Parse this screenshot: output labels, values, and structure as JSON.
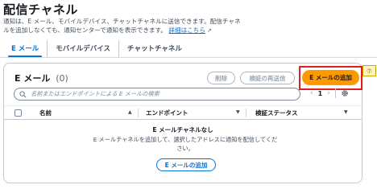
{
  "page": {
    "title": "配信チャネル",
    "description": "通知は、E メール、モバイルデバイス、チャットチャネルに送信できます。配信チャネルを追加しなくても、通知センターで通知を表示できます。",
    "link_label": "詳細はこちら",
    "link_icon": "external-link-icon"
  },
  "tabs": [
    {
      "label": "E メール",
      "active": true
    },
    {
      "label": "モバイルデバイス",
      "active": false
    },
    {
      "label": "チャットチャネル",
      "active": false
    }
  ],
  "email_section": {
    "title": "E メール",
    "count": "(0)",
    "delete_label": "削除",
    "resend_label": "検証の再送信",
    "add_label": "E メールの追加",
    "callout_number": "⑦",
    "search_placeholder": "名前またはエンドポイントによる E メールの検索",
    "pager": {
      "prev": "‹",
      "page": "1",
      "next": "›"
    },
    "columns": [
      "名前",
      "エンドポイント",
      "検証ステータス"
    ],
    "empty_title": "E メールチャネルなし",
    "empty_desc": "E メールチャネルを追加して、選択したアドレスに通知を配信してください。",
    "empty_add_label": "E メールの追加"
  },
  "colors": {
    "accent": "#0972d3",
    "primary_button": "#ff9900",
    "highlight": "#e01e1e"
  }
}
